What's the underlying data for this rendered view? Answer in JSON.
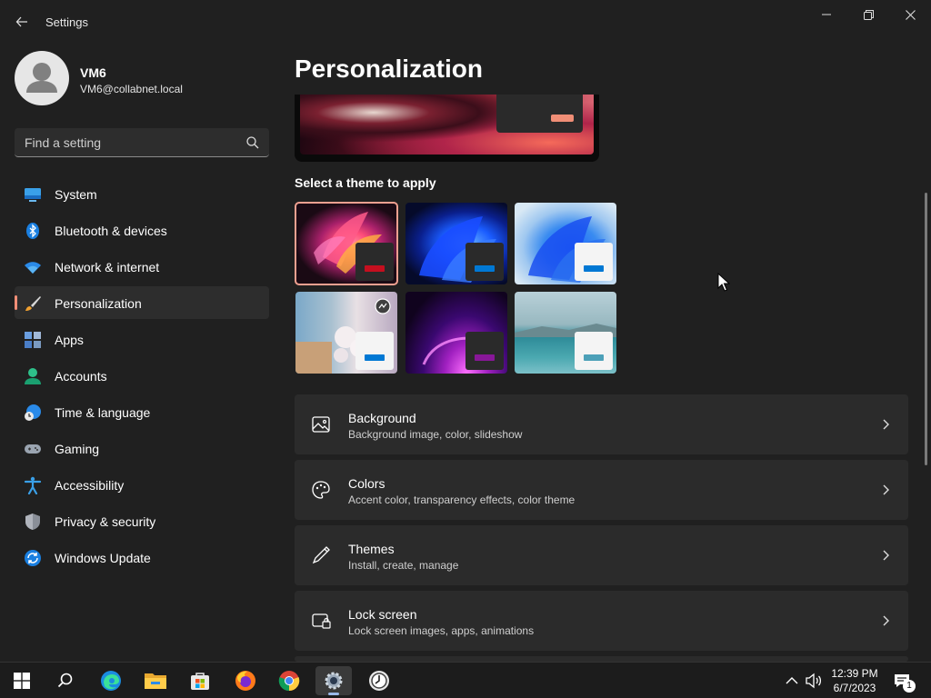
{
  "window": {
    "title": "Settings"
  },
  "profile": {
    "name": "VM6",
    "email": "VM6@collabnet.local"
  },
  "search": {
    "placeholder": "Find a setting"
  },
  "sidebar": {
    "items": [
      {
        "label": "System",
        "icon": "monitor-icon"
      },
      {
        "label": "Bluetooth & devices",
        "icon": "bluetooth-icon"
      },
      {
        "label": "Network & internet",
        "icon": "wifi-icon"
      },
      {
        "label": "Personalization",
        "icon": "brush-icon",
        "active": true
      },
      {
        "label": "Apps",
        "icon": "apps-icon"
      },
      {
        "label": "Accounts",
        "icon": "person-icon"
      },
      {
        "label": "Time & language",
        "icon": "globe-clock-icon"
      },
      {
        "label": "Gaming",
        "icon": "gamepad-icon"
      },
      {
        "label": "Accessibility",
        "icon": "accessibility-icon"
      },
      {
        "label": "Privacy & security",
        "icon": "shield-icon"
      },
      {
        "label": "Windows Update",
        "icon": "update-icon"
      }
    ]
  },
  "main": {
    "title": "Personalization",
    "themes_label": "Select a theme to apply",
    "themes": [
      {
        "name": "theme-glow",
        "accent": "#c50f1f",
        "selected": true
      },
      {
        "name": "theme-bloom-dark",
        "accent": "#0078d4"
      },
      {
        "name": "theme-bloom-light",
        "accent": "#0078d4"
      },
      {
        "name": "theme-flowers",
        "accent": "#0078d4"
      },
      {
        "name": "theme-purple-glow",
        "accent": "#881798"
      },
      {
        "name": "theme-lake",
        "accent": "#4ca0b8"
      }
    ],
    "cards": [
      {
        "title": "Background",
        "subtitle": "Background image, color, slideshow",
        "icon": "image-icon"
      },
      {
        "title": "Colors",
        "subtitle": "Accent color, transparency effects, color theme",
        "icon": "palette-icon"
      },
      {
        "title": "Themes",
        "subtitle": "Install, create, manage",
        "icon": "pen-icon"
      },
      {
        "title": "Lock screen",
        "subtitle": "Lock screen images, apps, animations",
        "icon": "lock-screen-icon"
      }
    ]
  },
  "taskbar": {
    "time": "12:39 PM",
    "date": "6/7/2023",
    "notification_count": "1"
  },
  "colors": {
    "accent": "#f08e76",
    "background": "#202020",
    "card": "#2b2b2b"
  }
}
